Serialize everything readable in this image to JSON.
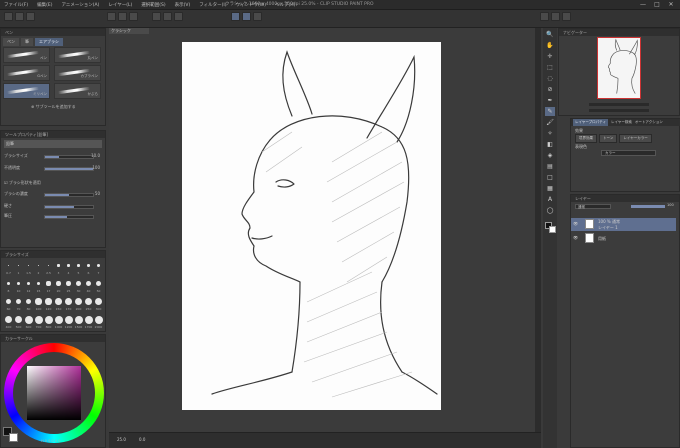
{
  "window": {
    "title": "クラシック 1800 x 4000px 350dpi 25.0% - CLIP STUDIO PAINT PRO",
    "menu": [
      "ファイル(F)",
      "編集(E)",
      "アニメーション(A)",
      "レイヤー(L)",
      "選択範囲(S)",
      "表示(V)",
      "フィルター(I)",
      "ウィンドウ(W)",
      "ヘルプ(H)"
    ],
    "controls": {
      "minimize": "—",
      "maximize": "□",
      "close": "✕"
    }
  },
  "canvas_tab": {
    "label": "クラシック"
  },
  "subtool_panel": {
    "tabs": [
      "ペン",
      "筆",
      "エアブラシ"
    ],
    "selected_tab": "ペン",
    "brushes": [
      {
        "label": "ペン"
      },
      {
        "label": "丸ペン"
      },
      {
        "label": "Gペン"
      },
      {
        "label": "カブラペン"
      },
      {
        "label": "ミリペン"
      },
      {
        "label": "かぶら"
      }
    ],
    "add_button": "サブツールを追加する"
  },
  "tool_property": {
    "header": "ツールプロパティ[鉛筆]",
    "tool_name": "鉛筆",
    "rows": [
      {
        "label": "ブラシサイズ",
        "value": "10.0",
        "fill": 0.3
      },
      {
        "label": "不透明度",
        "value": "100",
        "fill": 1.0
      },
      {
        "label": "ブラシの濃度",
        "value": "50",
        "fill": 0.5
      },
      {
        "label": "硬さ",
        "value": "",
        "fill": 0.6
      },
      {
        "label": "筆圧",
        "value": "",
        "fill": 0.45
      }
    ],
    "checkbox": "ブラシ形状を適用"
  },
  "brush_size": {
    "header": "ブラシサイズ",
    "sizes": [
      "0.7",
      "1",
      "1.5",
      "2",
      "2.5",
      "3",
      "4",
      "5",
      "6",
      "7",
      "8",
      "10",
      "12",
      "15",
      "17",
      "20",
      "25",
      "30",
      "40",
      "50",
      "60",
      "70",
      "80",
      "100",
      "120",
      "150",
      "170",
      "200",
      "250",
      "300",
      "400",
      "500",
      "600",
      "700",
      "800",
      "1000",
      "1200",
      "1500",
      "1700",
      "2000"
    ]
  },
  "color_wheel": {
    "header": "カラーサークル",
    "readout": "H 0  S 0  V 0"
  },
  "navigator": {
    "header": "ナビゲーター",
    "zoom": "25.0",
    "angle": "0.0"
  },
  "layer_property": {
    "header": "レイヤープロパティ",
    "tabs": [
      "レイヤープロパティ",
      "レイヤー検索",
      "オートアクション"
    ],
    "effect": "効果",
    "buttons": [
      "境界効果",
      "トーン",
      "レイヤーカラー"
    ],
    "expression_color": "表現色",
    "color_mode": "カラー"
  },
  "layers": {
    "header": "レイヤー",
    "blend": "通常",
    "opacity": "100",
    "items": [
      {
        "name": "100 % 通常",
        "sub": "レイヤー 1",
        "selected": true
      },
      {
        "name": "用紙",
        "sub": "",
        "selected": false
      }
    ]
  },
  "status": {
    "zoom": "25.0",
    "coords": "0.0"
  },
  "colors": {
    "accent": "#5a6a86",
    "selected_layer": "#5f6f90",
    "canvas_bg": "#fdfdfd",
    "panel_bg": "#3c3c3c",
    "color_picker_main": "#8a3a7a"
  }
}
